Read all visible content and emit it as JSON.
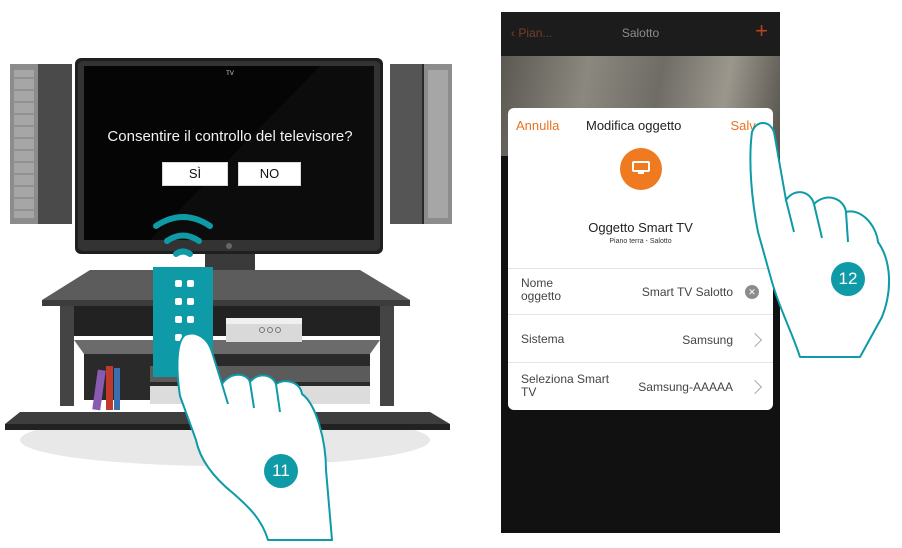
{
  "tv": {
    "brand": "TV",
    "prompt": "Consentire il controllo del televisore?",
    "yes_label": "SÌ",
    "no_label": "NO"
  },
  "steps": {
    "left": "11",
    "right": "12"
  },
  "phone": {
    "back_label": "Pian...",
    "title": "Salotto",
    "add_symbol": "+",
    "dialog": {
      "cancel_label": "Annulla",
      "title": "Modifica oggetto",
      "save_label": "Salva",
      "object_icon": "tv-icon",
      "object_name": "Oggetto Smart TV",
      "object_location": "Piano terra - Salotto",
      "rows": [
        {
          "label": "Nome oggetto",
          "value": "Smart TV Salotto",
          "action": "clear"
        },
        {
          "label": "Sistema",
          "value": "Samsung",
          "action": "chevron"
        },
        {
          "label": "Seleziona Smart TV",
          "value": "Samsung-AAAAA",
          "action": "chevron"
        }
      ]
    }
  },
  "colors": {
    "accent": "#e8731f",
    "teal": "#0e9aa7"
  }
}
